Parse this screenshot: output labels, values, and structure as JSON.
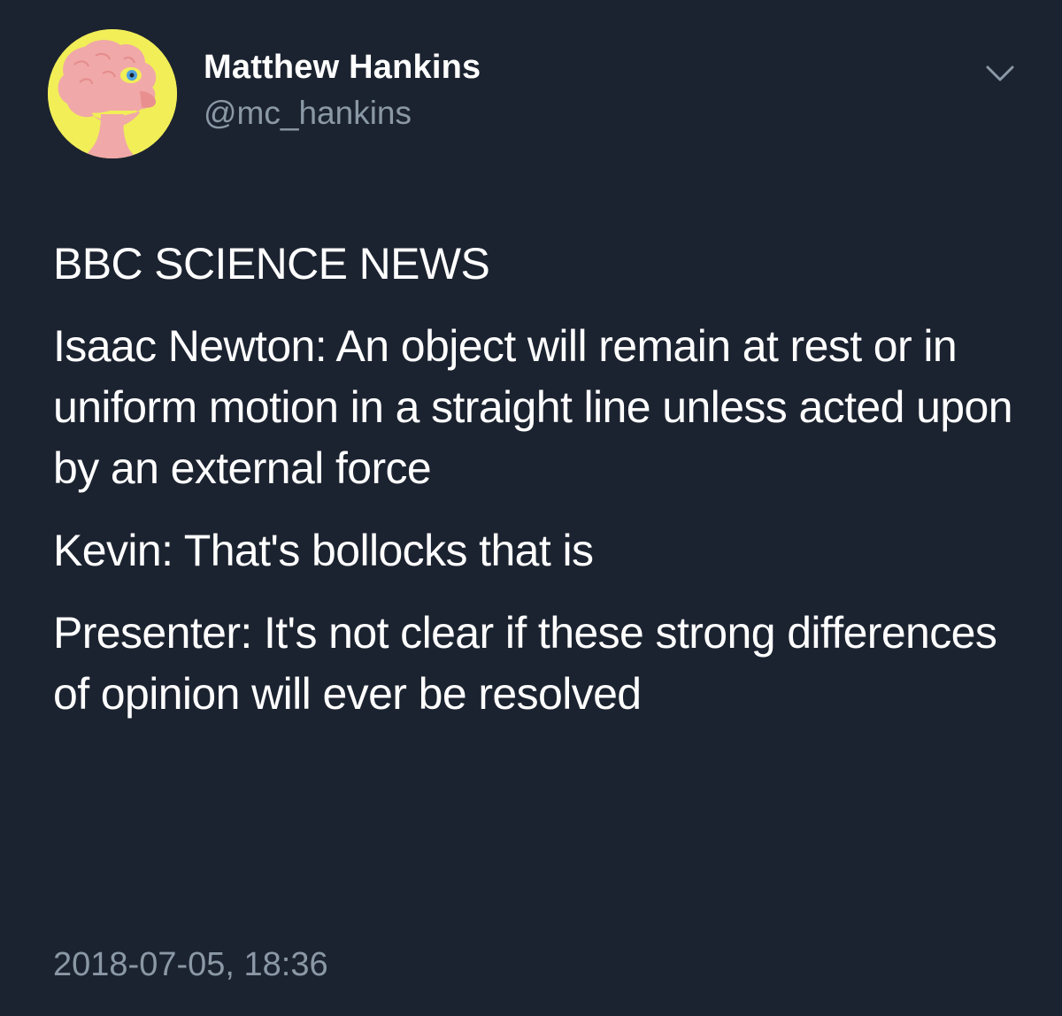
{
  "author": {
    "name": "Matthew Hankins",
    "handle": "@mc_hankins"
  },
  "avatar": {
    "icon": "cartoon-head-avatar",
    "background_color": "#f1ee58",
    "figure_color": "#f0a8a8"
  },
  "menu": {
    "icon": "chevron-down-icon"
  },
  "tweet": {
    "paragraphs": [
      "BBC SCIENCE NEWS",
      "Isaac Newton: An object will remain at rest or in uniform motion in a straight line unless acted upon by an external force",
      "Kevin: That's bollocks that is",
      "Presenter: It's not clear if these strong differences of opinion will ever be resolved"
    ],
    "timestamp": "2018-07-05, 18:36"
  },
  "colors": {
    "background": "#1c2330",
    "text": "#ffffff",
    "secondary_text": "#8b98a6"
  }
}
